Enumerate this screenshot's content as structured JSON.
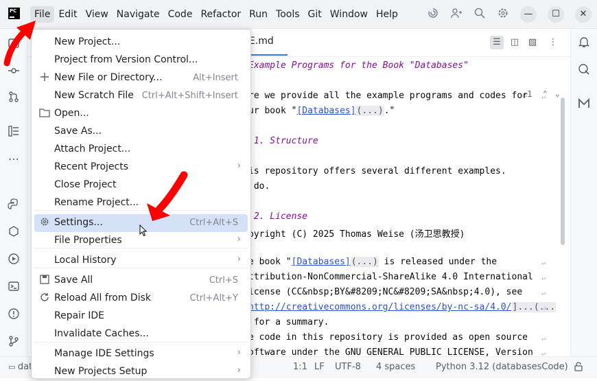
{
  "app": {
    "logo_text": "PC"
  },
  "menubar": {
    "items": [
      "File",
      "Edit",
      "View",
      "Navigate",
      "Code",
      "Refactor",
      "Run",
      "Tools",
      "Git",
      "Window",
      "Help"
    ],
    "active": "File"
  },
  "title_icons": [
    "spiral-icon",
    "add-user-icon",
    "search-icon",
    "settings-icon"
  ],
  "window_buttons": {
    "minimize": "—",
    "maximize": "☐",
    "close": "✕"
  },
  "editor": {
    "tab_label": "E.md",
    "warning": "⚠1",
    "lines": [
      {
        "kind": "heading",
        "text": "Example Programs for the Book \"Databases\""
      },
      {
        "kind": "text",
        "text": "re we provide all the example programs and codes for"
      },
      {
        "kind": "mixed",
        "pre": "ur book \"",
        "link": "[Databases]",
        "fold": "(...)",
        "post": ".\""
      },
      {
        "kind": "heading",
        "text": " 1. Structure"
      },
      {
        "kind": "text",
        "text": "is repository offers several different examples."
      },
      {
        "kind": "text",
        "text": " do."
      },
      {
        "kind": "heading",
        "text": " 2. License"
      },
      {
        "kind": "text",
        "text": "pyright (C) 2025 Thomas Weise (汤卫思教授)"
      },
      {
        "kind": "mixed",
        "pre": "e book \"",
        "link": "[Databases]",
        "fold": "(...)",
        "post": " is released under the"
      },
      {
        "kind": "text",
        "text": "ttribution-NonCommercial-ShareAlike 4.0 International"
      },
      {
        "kind": "text",
        "text": "icense (CC&nbsp;BY&#8209;NC&#8209;SA&nbsp;4.0), see"
      },
      {
        "kind": "linkline",
        "link": "http://creativecommons.org/licenses/by-nc-sa/4.0/",
        "fold": "]...(..."
      },
      {
        "kind": "text",
        "text": " for a summary."
      },
      {
        "kind": "text",
        "text": "e code in this repository is provided as open source"
      },
      {
        "kind": "text",
        "text": "oftware under the GNU GENERAL PUBLIC LICENSE, Version"
      }
    ]
  },
  "file_menu": {
    "items": [
      {
        "label": "New Project...",
        "shortcut": "",
        "submenu": false,
        "icon": ""
      },
      {
        "label": "Project from Version Control...",
        "shortcut": "",
        "submenu": false,
        "icon": ""
      },
      {
        "label": "New File or Directory...",
        "shortcut": "Alt+Insert",
        "submenu": false,
        "icon": "plus-icon"
      },
      {
        "label": "New Scratch File",
        "shortcut": "Ctrl+Alt+Shift+Insert",
        "submenu": false,
        "icon": ""
      },
      {
        "label": "Open...",
        "shortcut": "",
        "submenu": false,
        "icon": "folder-icon"
      },
      {
        "label": "Save As...",
        "shortcut": "",
        "submenu": false,
        "icon": ""
      },
      {
        "label": "Attach Project...",
        "shortcut": "",
        "submenu": false,
        "icon": ""
      },
      {
        "label": "Recent Projects",
        "shortcut": "",
        "submenu": true,
        "icon": ""
      },
      {
        "label": "Close Project",
        "shortcut": "",
        "submenu": false,
        "icon": ""
      },
      {
        "label": "Rename Project...",
        "shortcut": "",
        "submenu": false,
        "icon": ""
      },
      {
        "label": "Settings...",
        "shortcut": "Ctrl+Alt+S",
        "submenu": false,
        "icon": "gear-icon",
        "highlighted": true
      },
      {
        "label": "File Properties",
        "shortcut": "",
        "submenu": true,
        "icon": ""
      },
      {
        "label": "Local History",
        "shortcut": "",
        "submenu": true,
        "icon": ""
      },
      {
        "label": "Save All",
        "shortcut": "Ctrl+S",
        "submenu": false,
        "icon": "save-icon"
      },
      {
        "label": "Reload All from Disk",
        "shortcut": "Ctrl+Alt+Y",
        "submenu": false,
        "icon": "reload-icon"
      },
      {
        "label": "Repair IDE",
        "shortcut": "",
        "submenu": false,
        "icon": ""
      },
      {
        "label": "Invalidate Caches...",
        "shortcut": "",
        "submenu": false,
        "icon": ""
      },
      {
        "label": "Manage IDE Settings",
        "shortcut": "",
        "submenu": true,
        "icon": ""
      },
      {
        "label": "New Projects Setup",
        "shortcut": "",
        "submenu": true,
        "icon": ""
      }
    ]
  },
  "statusbar": {
    "project": "dat",
    "position": "1:1",
    "line_sep": "LF",
    "encoding": "UTF-8",
    "indent": "4 spaces",
    "interpreter": "Python 3.12 (databasesCode)"
  },
  "colors": {
    "annotation": "#ff0000",
    "highlight": "#d5e1f6",
    "accent": "#3574f0"
  }
}
